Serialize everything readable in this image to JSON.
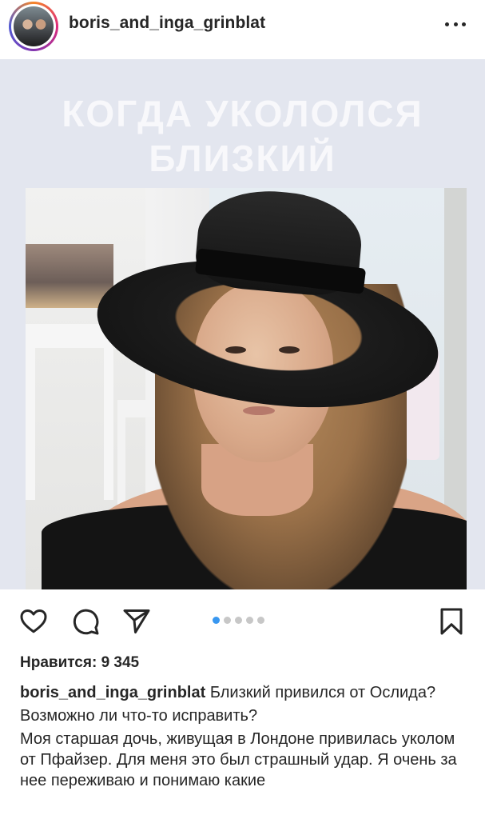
{
  "header": {
    "username": "boris_and_inga_grinblat",
    "avatar_icon": "profile-avatar",
    "more_icon": "more-horizontal-icon"
  },
  "post": {
    "title": "КОГДА УКОЛОЛСЯ БЛИЗКИЙ",
    "carousel": {
      "count": 5,
      "active_index": 0
    }
  },
  "actions": {
    "like_icon": "heart-icon",
    "comment_icon": "comment-icon",
    "share_icon": "send-icon",
    "save_icon": "bookmark-icon"
  },
  "likes": {
    "text": "Нравится: 9 345"
  },
  "caption": {
    "username": "boris_and_inga_grinblat",
    "text": " Близкий привился от Ослида?",
    "question": "Возможно ли что-то исправить?",
    "body": "Моя старшая дочь, живущая в Лондоне привилась уколом от Пфайзер. Для меня это был страшный удар. Я очень за нее переживаю и понимаю какие"
  },
  "colors": {
    "text": "#262626",
    "post_background": "#e3e6ef",
    "title_color": "#f8f8fb",
    "active_dot": "#3897f0",
    "inactive_dot": "#c7c7c7"
  }
}
